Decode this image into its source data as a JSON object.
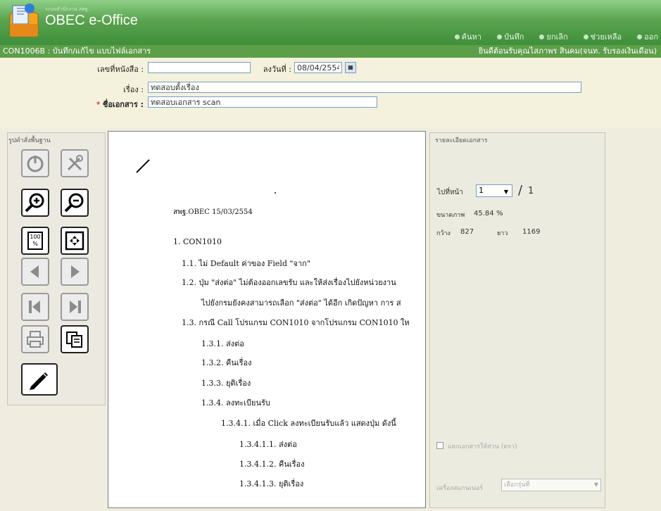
{
  "app": {
    "subtitle": "ระบบสำนักงาน สพฐ.",
    "title": "OBEC e-Office"
  },
  "topnav": {
    "items": [
      "ค้นหา",
      "บันทึก",
      "ยกเลิก",
      "ช่วยเหลือ",
      "ออก"
    ]
  },
  "statusbar": {
    "left": "CON1006B : บันทึก/แก้ไข แบบไฟล์เอกสาร",
    "right": "ยินดีต้อนรับคุณไสภาพร สินคม(จนท. รับรองเงินเดือน)"
  },
  "form": {
    "doc_no_label": "เลขที่หนังสือ :",
    "doc_no_value": "",
    "date_label": "ลงวันที่ :",
    "date_value": "08/04/2554",
    "subject_label": "เรื่อง :",
    "subject_value": "ทดสอบตั้งเรื่อง",
    "filename_req": "*",
    "filename_label": "ชื่อเอกสาร :",
    "filename_value": "ทดสอบเอกสาร scan"
  },
  "toolbox": {
    "title": "รูปคำสั่งพื้นฐาน",
    "icons": {
      "power": "power-icon",
      "tools": "tools-icon",
      "zoom_in": "zoom-in-icon",
      "zoom_out": "zoom-out-icon",
      "actual_size": "actual-size-icon",
      "fit_page": "fit-page-icon",
      "prev": "prev-page-icon",
      "next": "next-page-icon",
      "first": "first-page-icon",
      "last": "last-page-icon",
      "print": "print-icon",
      "copy": "copy-icon",
      "annotate": "pencil-icon"
    },
    "actual_size_label_top": "100",
    "actual_size_label_bottom": "%"
  },
  "document": {
    "lines": [
      "สพฐ.OBEC 15/03/2554",
      "1.   CON1010",
      "1.1.  ไม่ Default ค่าของ Field \"จาก\"",
      "1.2.  ปุ่ม \"ส่งต่อ\" ไม่ต้องออกเลขรับ และให้ส่งเรื่องไปยังหน่วยงาน",
      "ไปยังกรมยังคงสามารถเลือก \"ส่งต่อ\" ได้อีก เกิดปัญหา การ ส",
      "1.3.  กรณี Call โปรแกรม CON1010 จากโปรแกรม CON1010 ให",
      "1.3.1.  ส่งต่อ",
      "1.3.2.  คืนเรื่อง",
      "1.3.3.  ยุติเรื่อง",
      "1.3.4.  ลงทะเบียนรับ",
      "1.3.4.1.  เมื่อ Click ลงทะเบียนรับแล้ว แสดงปุ่ม ดังนี้",
      "1.3.4.1.1.  ส่งต่อ",
      "1.3.4.1.2.  คืนเรื่อง",
      "1.3.4.1.3.  ยุติเรื่อง"
    ]
  },
  "sidepanel": {
    "title": "รายละเอียดเอกสาร",
    "page_label": "ไปที่หน้า",
    "page_value": "1",
    "page_sep": "/",
    "page_total": "1",
    "zoom_label": "ขนาดภาพ",
    "zoom_value": "45.84",
    "zoom_unit": "%",
    "width_label": "กว้าง",
    "width_value": "827",
    "height_label": "ยาว",
    "height_value": "1169",
    "checkbox_label": "แยกเอกสารให้ส่วน (ตรา)",
    "scanner_label": "เครื่องสแกนเนอร์",
    "scanner_value": "เลือกรุ่นที่"
  },
  "colors": {
    "header_green": "#5aa34f",
    "status_green": "#5d9e48",
    "accent_red": "#cc0000"
  }
}
